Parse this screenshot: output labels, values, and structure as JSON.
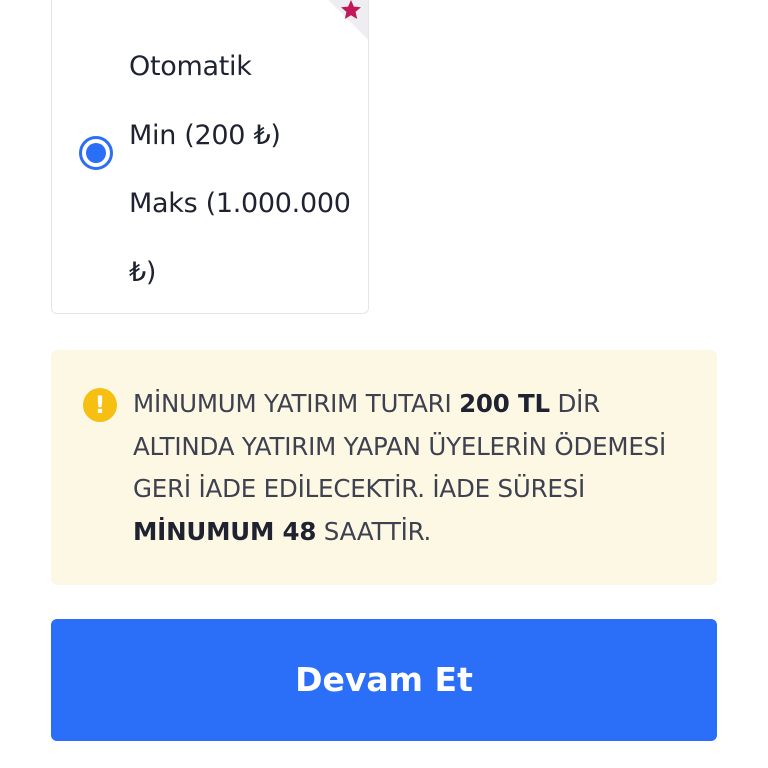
{
  "payment_option": {
    "title": "Otomatik",
    "min_label": "Min (200 ₺)",
    "max_label_line1": "Maks (1.000.000",
    "max_label_line2": "₺)",
    "selected": true,
    "badge_icon": "star-icon"
  },
  "warning": {
    "icon": "exclamation-icon",
    "icon_glyph": "!",
    "text_part1": "MİNUMUM YATIRIM TUTARI ",
    "text_bold1": "200 TL",
    "text_part2": " DİR ALTINDA YATIRIM YAPAN ÜYELERİN ÖDEMESİ GERİ İADE EDİLECEKTİR. İADE SÜRESİ ",
    "text_bold2": "MİNUMUM 48",
    "text_part3": " SAATTİR."
  },
  "continue_button": {
    "label": "Devam Et"
  },
  "colors": {
    "accent": "#2b6ef7",
    "warning_bg": "#fdf8e3",
    "warning_icon": "#f6bf12",
    "star": "#c2185b"
  }
}
